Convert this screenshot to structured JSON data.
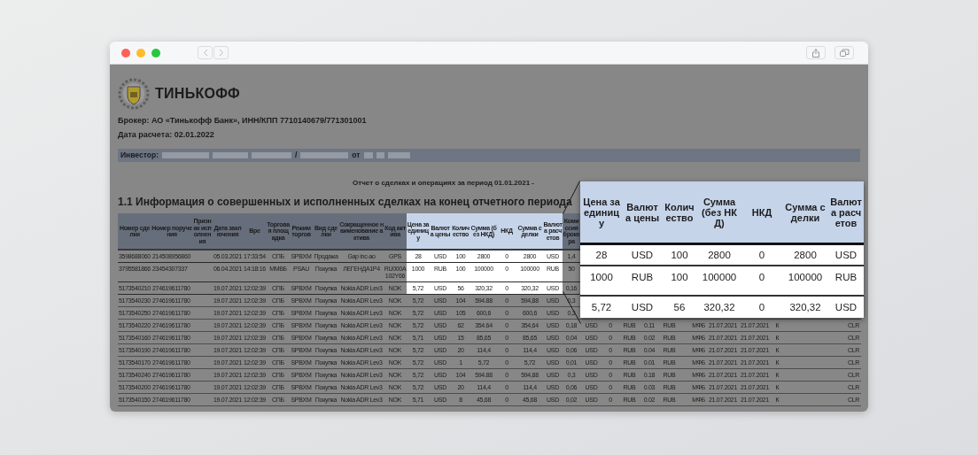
{
  "toolbar": {
    "back": {
      "disabled": true
    },
    "forward": {
      "disabled": true
    }
  },
  "logo": {
    "text": "ТИНЬКОФФ"
  },
  "broker": "Брокер: АО «Тинькофф Банк», ИНН/КПП 7710140679/771301001",
  "settlement_date": "Дата расчета: 02.01.2022",
  "investor": {
    "label": "Инвестор:",
    "separator": "/",
    "date_prefix": "от"
  },
  "report_title": "Отчет о сделках и операциях за период 01.01.2021 -",
  "section_title": "1.1 Информация о совершенных и исполненных сделках на конец отчетного периода",
  "table": {
    "columns": [
      {
        "header": "Номер сделки",
        "highlighted": false
      },
      {
        "header": "Номер поручения",
        "highlighted": false
      },
      {
        "header": "Признак исполнения",
        "highlighted": false
      },
      {
        "header": "Дата заключения",
        "highlighted": false
      },
      {
        "header": "Вре",
        "highlighted": false
      },
      {
        "header": "Торговая площадка",
        "highlighted": false
      },
      {
        "header": "Режим торгов",
        "highlighted": false
      },
      {
        "header": "Вид сделки",
        "highlighted": false
      },
      {
        "header": "Сокращенное наименование актива",
        "highlighted": false
      },
      {
        "header": "Код актива",
        "highlighted": false
      },
      {
        "header": "Цена за единицу",
        "highlighted": true
      },
      {
        "header": "Валюта цены",
        "highlighted": true
      },
      {
        "header": "Количество",
        "highlighted": true
      },
      {
        "header": "Сумма (без НКД)",
        "highlighted": true
      },
      {
        "header": "НКД",
        "highlighted": true
      },
      {
        "header": "Сумма сделки",
        "highlighted": true
      },
      {
        "header": "Валюта расчетов",
        "highlighted": true
      },
      {
        "header": "Комиссия брокера",
        "highlighted": false
      }
    ],
    "rows": [
      {
        "highlighted": true,
        "cells": [
          "3598688060",
          "214508956860",
          "",
          "05.03.2021",
          "17:33:54",
          "СПБ",
          "SPBXM",
          "Продажа",
          "Gap inc-ao",
          "GPS",
          "28",
          "USD",
          "100",
          "2800",
          "0",
          "2800",
          "USD",
          "1,4"
        ]
      },
      {
        "highlighted": true,
        "cells": [
          "3795581866",
          "23454307337",
          "",
          "06.04.2021",
          "14:18:16",
          "ММВБ",
          "PSAU",
          "Покупка",
          "ЛЕГЕНДА1Р4",
          "RU000A102Y66",
          "1000",
          "RUB",
          "100",
          "100000",
          "0",
          "100000",
          "RUB",
          "50"
        ]
      },
      {
        "highlighted": true,
        "cells": [
          "5173540210",
          "274619611780",
          "",
          "19.07.2021",
          "12:02:39",
          "СПБ",
          "SPBXM",
          "Покупка",
          "Nokia ADR Lev3",
          "NOK",
          "5,72",
          "USD",
          "56",
          "320,32",
          "0",
          "320,32",
          "USD",
          "0,16"
        ]
      },
      {
        "highlighted": false,
        "cells": [
          "5173540230",
          "274619611780",
          "",
          "19.07.2021",
          "12:02:39",
          "СПБ",
          "SPBXM",
          "Покупка",
          "Nokia ADR Lev3",
          "NOK",
          "5,72",
          "USD",
          "104",
          "594.88",
          "0",
          "594,88",
          "USD",
          "0,3"
        ]
      },
      {
        "highlighted": false,
        "cells": [
          "5173540250",
          "274619611780",
          "",
          "19.07.2021",
          "12:02:39",
          "СПБ",
          "SPBXM",
          "Покупка",
          "Nokia ADR Lev3",
          "NOK",
          "5,72",
          "USD",
          "105",
          "600,6",
          "0",
          "600,6",
          "USD",
          "0,3"
        ]
      },
      {
        "highlighted": false,
        "cells": [
          "5173540220",
          "274619611780",
          "",
          "19.07.2021",
          "12:02:39",
          "СПБ",
          "SPBXM",
          "Покупка",
          "Nokia ADR Lev3",
          "NOK",
          "5,72",
          "USD",
          "62",
          "354.64",
          "0",
          "354,64",
          "USD",
          "0,18",
          "USD",
          "0",
          "RUB",
          "0.11",
          "RUB",
          "МФБ",
          "21.07.2021",
          "21.07.2021",
          "К",
          "CLR"
        ]
      },
      {
        "highlighted": false,
        "cells": [
          "5173540160",
          "274619611780",
          "",
          "19.07.2021",
          "12:02:39",
          "СПБ",
          "SPBXM",
          "Покупка",
          "Nokia ADR Lev3",
          "NOK",
          "5,71",
          "USD",
          "15",
          "85,65",
          "0",
          "85,65",
          "USD",
          "0,04",
          "USD",
          "0",
          "RUB",
          "0.02",
          "RUB",
          "МФБ",
          "21.07.2021",
          "21.07.2021",
          "К",
          "CLR"
        ]
      },
      {
        "highlighted": false,
        "cells": [
          "5173540190",
          "274619611780",
          "",
          "19.07.2021",
          "12:02:39",
          "СПБ",
          "SPBXM",
          "Покупка",
          "Nokia ADR Lev3",
          "NOK",
          "5,72",
          "USD",
          "20",
          "114,4",
          "0",
          "114,4",
          "USD",
          "0,06",
          "USD",
          "0",
          "RUB",
          "0.04",
          "RUB",
          "МФБ",
          "21.07.2021",
          "21.07.2021",
          "К",
          "CLR"
        ]
      },
      {
        "highlighted": false,
        "cells": [
          "5173540170",
          "274619611780",
          "",
          "19.07.2021",
          "12:02:39",
          "СПБ",
          "SPBXM",
          "Покупка",
          "Nokia ADR Lev3",
          "NOK",
          "5,72",
          "USD",
          "1",
          "5,72",
          "0",
          "5,72",
          "USD",
          "0,01",
          "USD",
          "0",
          "RUB",
          "0.01",
          "RUB",
          "МФБ",
          "21.07.2021",
          "21.07.2021",
          "К",
          "CLR"
        ]
      },
      {
        "highlighted": false,
        "cells": [
          "5173540240",
          "274619611780",
          "",
          "19.07.2021",
          "12:02:39",
          "СПБ",
          "SPBXM",
          "Покупка",
          "Nokia ADR Lev3",
          "NOK",
          "5,72",
          "USD",
          "104",
          "594.88",
          "0",
          "594,88",
          "USD",
          "0,3",
          "USD",
          "0",
          "RUB",
          "0.18",
          "RUB",
          "МФБ",
          "21.07.2021",
          "21.07.2021",
          "К",
          "CLR"
        ]
      },
      {
        "highlighted": false,
        "cells": [
          "5173540200",
          "274619611780",
          "",
          "19.07.2021",
          "12:02:39",
          "СПБ",
          "SPBXM",
          "Покупка",
          "Nokia ADR Lev3",
          "NOK",
          "5,72",
          "USD",
          "20",
          "114,4",
          "0",
          "114,4",
          "USD",
          "0,06",
          "USD",
          "0",
          "RUB",
          "0.03",
          "RUB",
          "МФБ",
          "21.07.2021",
          "21.07.2021",
          "К",
          "CLR"
        ]
      },
      {
        "highlighted": false,
        "cells": [
          "5173540150",
          "274619611780",
          "",
          "19.07.2021",
          "12:02:39",
          "СПБ",
          "SPBXM",
          "Покупка",
          "Nokia ADR Lev3",
          "NOK",
          "5,71",
          "USD",
          "8",
          "45,68",
          "0",
          "45,68",
          "USD",
          "0,02",
          "USD",
          "0",
          "RUB",
          "0.02",
          "RUB",
          "МФБ",
          "21.07.2021",
          "21.07.2021",
          "К",
          "CLR"
        ]
      }
    ]
  },
  "callout": {
    "columns": [
      "Цена за единицу",
      "Валюта цены",
      "Количество",
      "Сумма (без НКД)",
      "НКД",
      "Сумма сделки",
      "Валюта расчетов"
    ],
    "rows": [
      [
        "28",
        "USD",
        "100",
        "2800",
        "0",
        "2800",
        "USD"
      ],
      [
        "1000",
        "RUB",
        "100",
        "100000",
        "0",
        "100000",
        "RUB"
      ],
      [
        "5,72",
        "USD",
        "56",
        "320,32",
        "0",
        "320,32",
        "USD"
      ]
    ]
  }
}
